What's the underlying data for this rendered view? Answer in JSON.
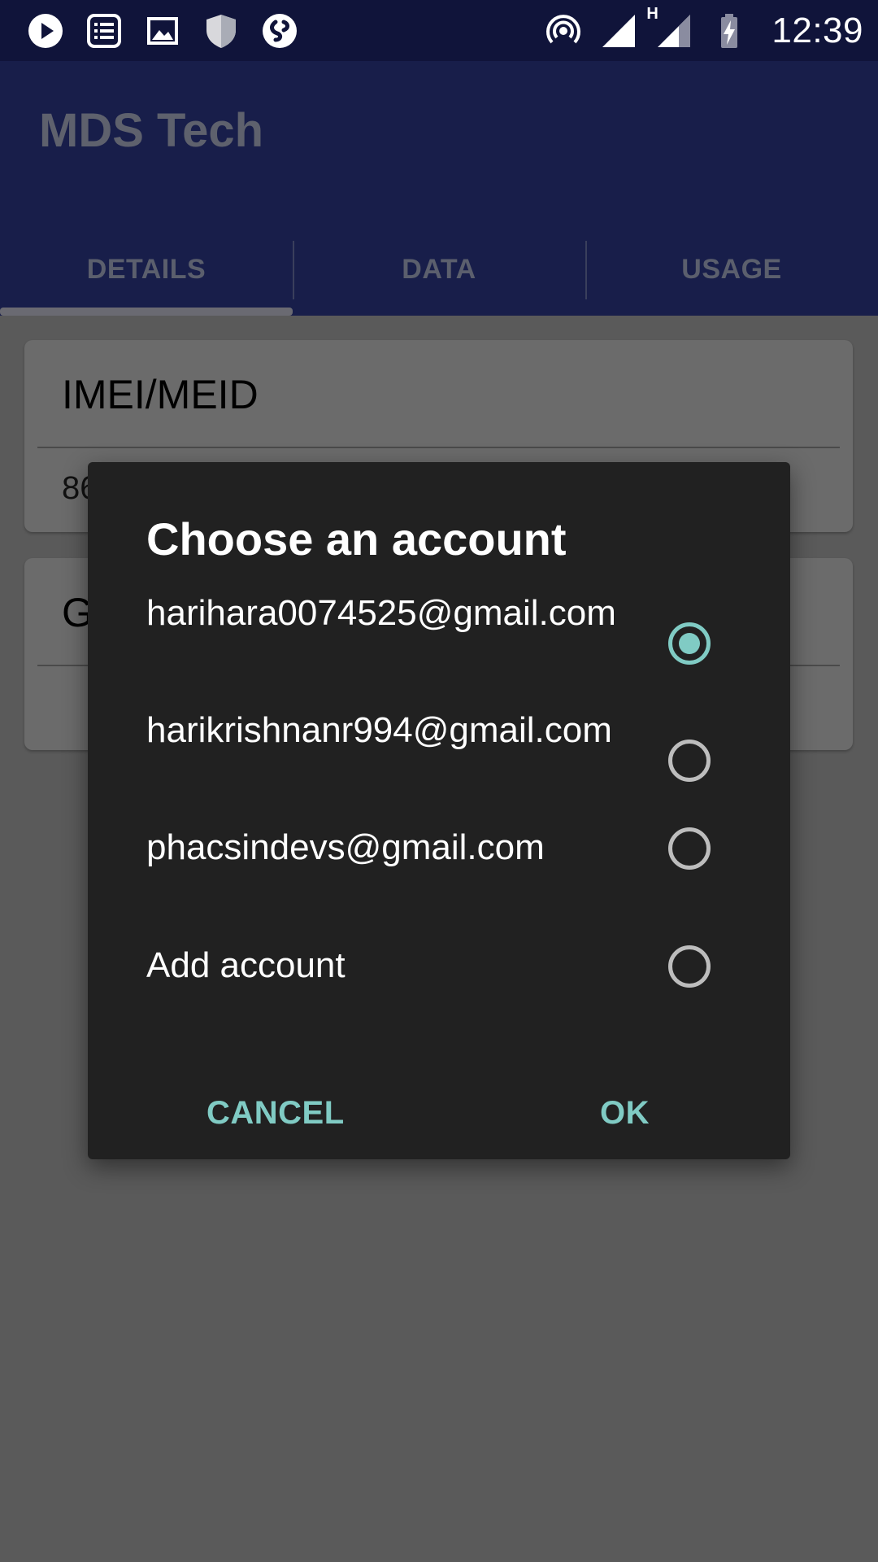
{
  "status_bar": {
    "left_icons": [
      "play-icon",
      "document-list-icon",
      "image-icon",
      "shield-icon",
      "shazam-icon"
    ],
    "right_icons": [
      "hotspot-icon",
      "signal-icon",
      "signal-h-icon",
      "battery-charging-icon"
    ],
    "network_type": "H",
    "time": "12:39"
  },
  "app_bar": {
    "title": "MDS Tech",
    "tabs": [
      {
        "label": "DETAILS",
        "selected": true
      },
      {
        "label": "DATA",
        "selected": false
      },
      {
        "label": "USAGE",
        "selected": false
      }
    ]
  },
  "background_cards": [
    {
      "title": "IMEI/MEID",
      "value": "86"
    },
    {
      "title": "G",
      "value": ""
    }
  ],
  "dialog": {
    "title": "Choose an account",
    "options": [
      {
        "label": "harihara0074525@gmail.com",
        "checked": true
      },
      {
        "label": "harikrishnanr994@gmail.com",
        "checked": false
      },
      {
        "label": "phacsindevs@gmail.com",
        "checked": false
      },
      {
        "label": "Add account",
        "checked": false
      }
    ],
    "cancel_label": "CANCEL",
    "ok_label": "OK"
  },
  "colors": {
    "status_bar": "#10143a",
    "app_bar": "#181e4a",
    "dialog_bg": "#212121",
    "accent": "#80cbc4",
    "scrim_bg": "#5a5a5a"
  }
}
